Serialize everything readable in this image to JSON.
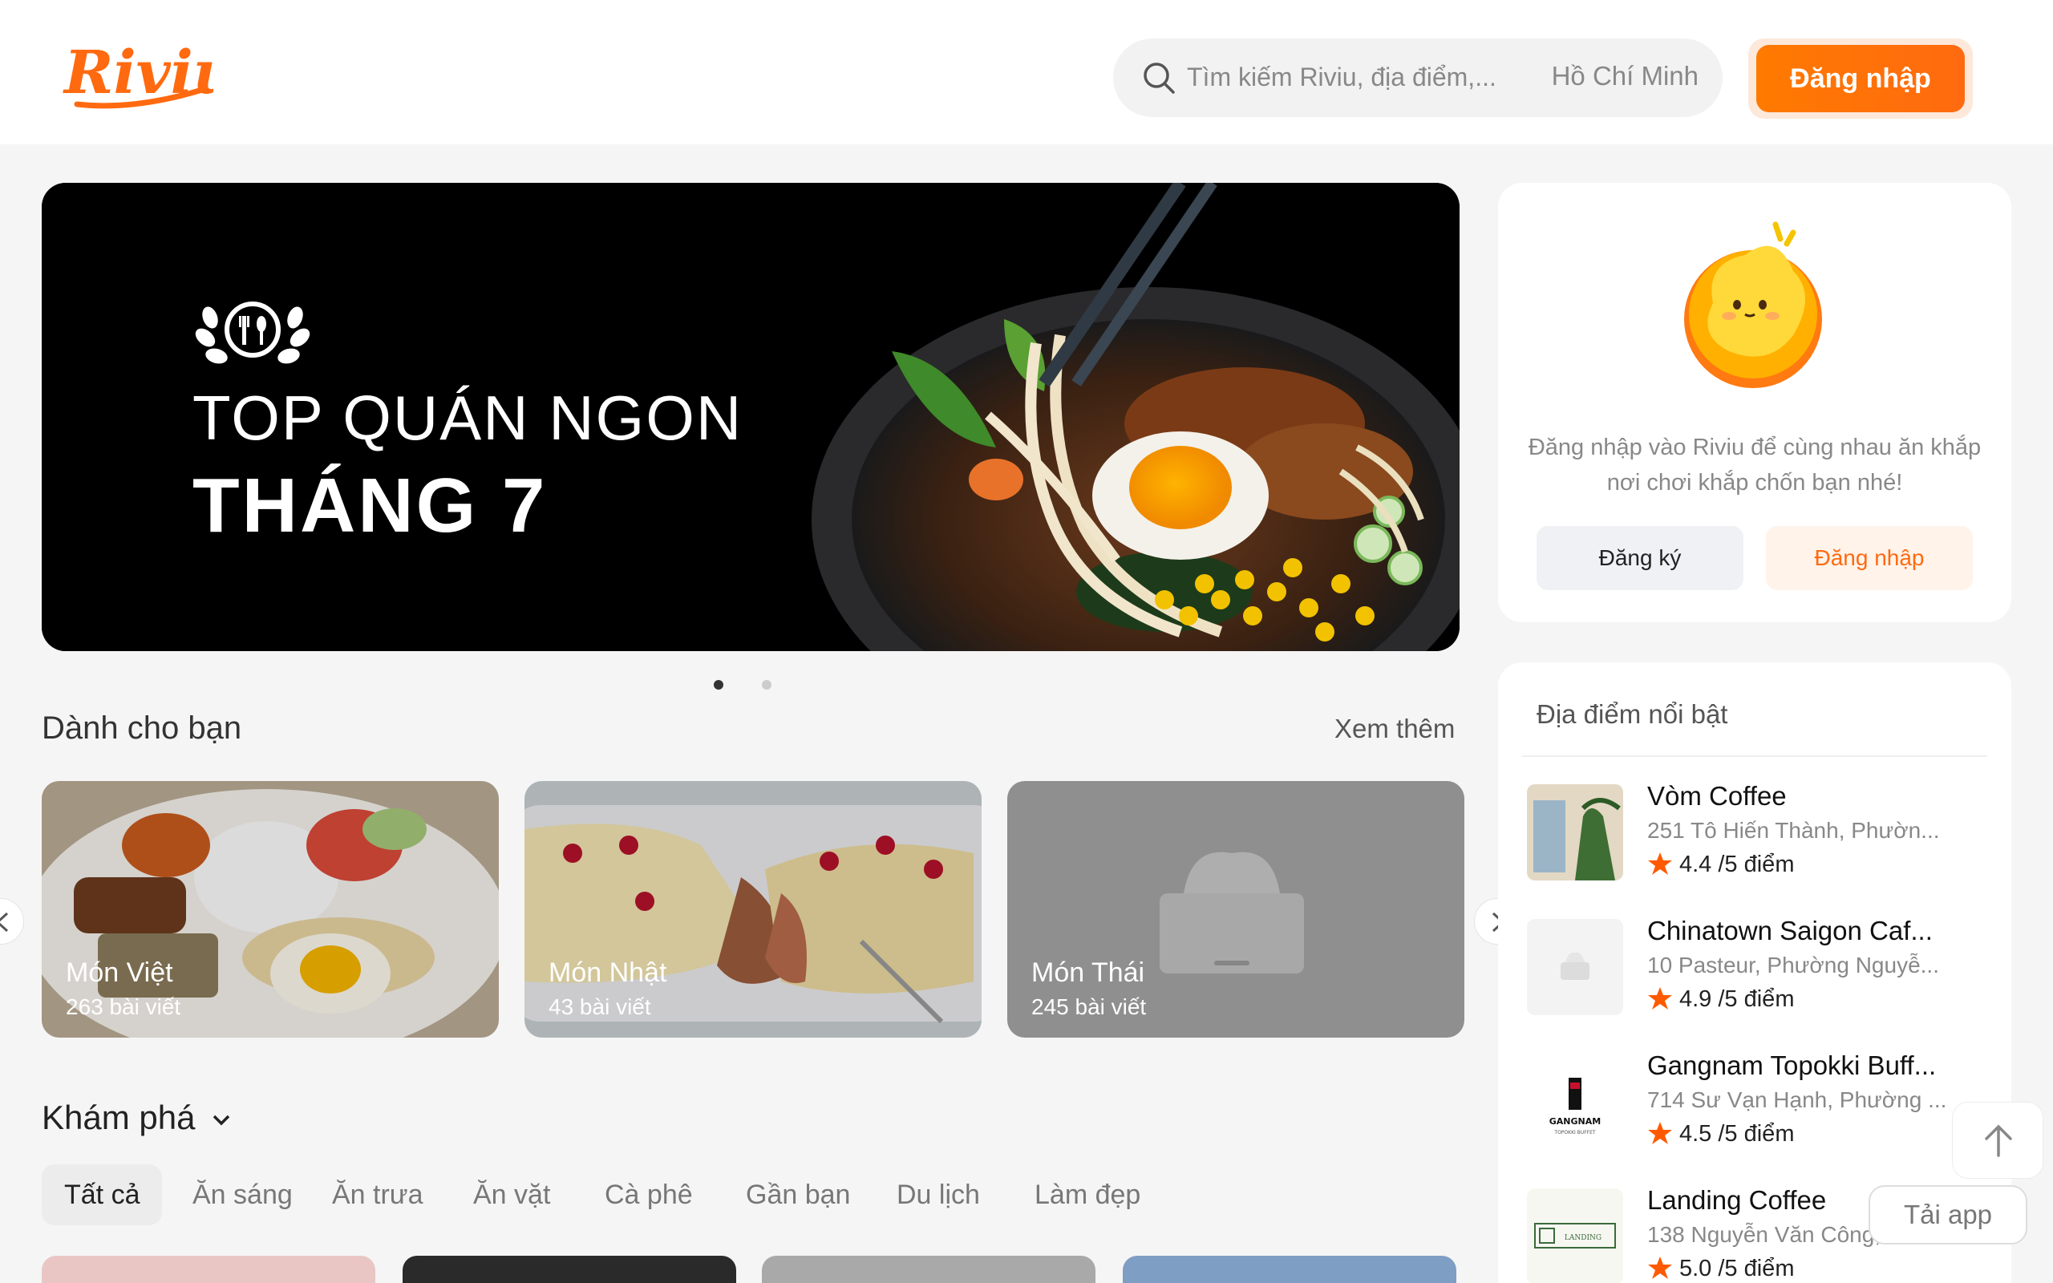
{
  "header": {
    "search_placeholder": "Tìm kiếm Riviu, địa điểm,...",
    "city": "Hồ Chí Minh",
    "login_label": "Đăng nhập",
    "brand_color": "#ff6a10"
  },
  "banner": {
    "line1": "TOP QUÁN NGON",
    "line2": "THÁNG 7"
  },
  "for_you": {
    "title": "Dành cho bạn",
    "see_more": "Xem thêm",
    "categories": [
      {
        "name": "Món Việt",
        "count": "263 bài viết"
      },
      {
        "name": "Món Nhật",
        "count": "43 bài viết"
      },
      {
        "name": "Món Thái",
        "count": "245 bài viết"
      }
    ]
  },
  "explore": {
    "title": "Khám phá",
    "tabs": [
      "Tất cả",
      "Ăn sáng",
      "Ăn trưa",
      "Ăn vặt",
      "Cà phê",
      "Gần bạn",
      "Du lịch",
      "Làm đẹp"
    ]
  },
  "login_card": {
    "message": "Đăng nhập vào Riviu để cùng nhau ăn khắp nơi chơi khắp chốn bạn nhé!",
    "register_label": "Đăng ký",
    "login_label": "Đăng nhập"
  },
  "places": {
    "title": "Địa điểm nổi bật",
    "items": [
      {
        "name": "Vòm Coffee",
        "address": "251 Tô Hiến Thành, Phườn...",
        "rating": "4.4 /5 điểm"
      },
      {
        "name": "Chinatown Saigon Caf...",
        "address": "10 Pasteur, Phường Nguyễ...",
        "rating": "4.9 /5 điểm"
      },
      {
        "name": "Gangnam Topokki Buff...",
        "address": "714 Sư Vạn Hạnh, Phường ...",
        "rating": "4.5 /5 điểm"
      },
      {
        "name": "Landing Coffee",
        "address": "138 Nguyễn Văn Công,",
        "rating": "5.0 /5 điểm"
      }
    ]
  },
  "floating": {
    "get_app": "Tải app"
  }
}
